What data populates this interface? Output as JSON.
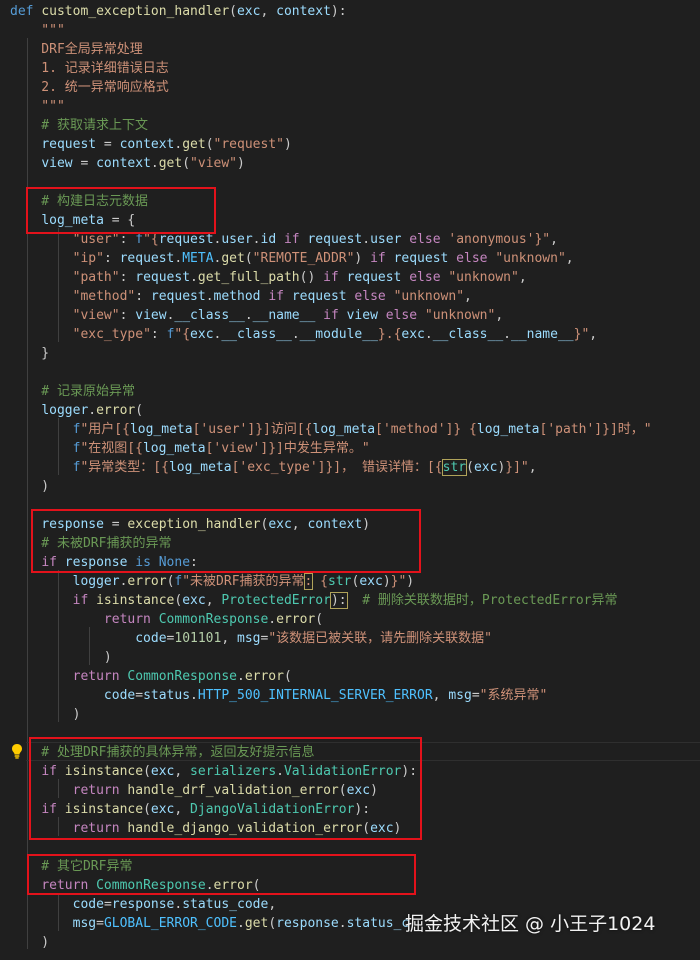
{
  "editor": {
    "theme_colors": {
      "background": "#1f1f1f",
      "keyword": "#569cd6",
      "control": "#c586c0",
      "function": "#dcdcaa",
      "variable": "#9cdcfe",
      "string": "#ce9178",
      "comment": "#6a9955",
      "class": "#4ec9b0",
      "number": "#b5cea8",
      "highlight_box": "#e3121b"
    },
    "gutter_icon": "lightbulb-icon",
    "lines": [
      [
        [
          "def ",
          "#569cd6"
        ],
        [
          "custom_exception_handler",
          "#dcdcaa"
        ],
        [
          "(",
          "#cccccc"
        ],
        [
          "exc",
          "#9cdcfe"
        ],
        [
          ", ",
          "#cccccc"
        ],
        [
          "context",
          "#9cdcfe"
        ],
        [
          "):",
          "#cccccc"
        ]
      ],
      [
        [
          "    \"\"\"",
          "#ce9178"
        ]
      ],
      [
        [
          "    DRF全局异常处理",
          "#ce9178"
        ]
      ],
      [
        [
          "    1. 记录详细错误日志",
          "#ce9178"
        ]
      ],
      [
        [
          "    2. 统一异常响应格式",
          "#ce9178"
        ]
      ],
      [
        [
          "    \"\"\"",
          "#ce9178"
        ]
      ],
      [
        [
          "    # 获取请求上下文",
          "#6a9955"
        ]
      ],
      [
        [
          "    ",
          "#cccccc"
        ],
        [
          "request",
          "#9cdcfe"
        ],
        [
          " = ",
          "#cccccc"
        ],
        [
          "context",
          "#9cdcfe"
        ],
        [
          ".",
          "#cccccc"
        ],
        [
          "get",
          "#dcdcaa"
        ],
        [
          "(",
          "#cccccc"
        ],
        [
          "\"request\"",
          "#ce9178"
        ],
        [
          ")",
          "#cccccc"
        ]
      ],
      [
        [
          "    ",
          "#cccccc"
        ],
        [
          "view",
          "#9cdcfe"
        ],
        [
          " = ",
          "#cccccc"
        ],
        [
          "context",
          "#9cdcfe"
        ],
        [
          ".",
          "#cccccc"
        ],
        [
          "get",
          "#dcdcaa"
        ],
        [
          "(",
          "#cccccc"
        ],
        [
          "\"view\"",
          "#ce9178"
        ],
        [
          ")",
          "#cccccc"
        ]
      ],
      [],
      [
        [
          "    # 构建日志元数据",
          "#6a9955"
        ]
      ],
      [
        [
          "    ",
          "#cccccc"
        ],
        [
          "log_meta",
          "#9cdcfe"
        ],
        [
          " = {",
          "#cccccc"
        ]
      ],
      [
        [
          "        ",
          "#cccccc"
        ],
        [
          "\"user\"",
          "#ce9178"
        ],
        [
          ": ",
          "#cccccc"
        ],
        [
          "f",
          "#569cd6"
        ],
        [
          "\"{",
          "#ce9178"
        ],
        [
          "request",
          "#9cdcfe"
        ],
        [
          ".",
          "#cccccc"
        ],
        [
          "user",
          "#9cdcfe"
        ],
        [
          ".",
          "#cccccc"
        ],
        [
          "id",
          "#9cdcfe"
        ],
        [
          " if ",
          "#c586c0"
        ],
        [
          "request",
          "#9cdcfe"
        ],
        [
          ".",
          "#cccccc"
        ],
        [
          "user",
          "#9cdcfe"
        ],
        [
          " else ",
          "#c586c0"
        ],
        [
          "'anonymous'",
          "#ce9178"
        ],
        [
          "}\"",
          "#ce9178"
        ],
        [
          ",",
          "#cccccc"
        ]
      ],
      [
        [
          "        ",
          "#cccccc"
        ],
        [
          "\"ip\"",
          "#ce9178"
        ],
        [
          ": ",
          "#cccccc"
        ],
        [
          "request",
          "#9cdcfe"
        ],
        [
          ".",
          "#cccccc"
        ],
        [
          "META",
          "#4fc1ff"
        ],
        [
          ".",
          "#cccccc"
        ],
        [
          "get",
          "#dcdcaa"
        ],
        [
          "(",
          "#cccccc"
        ],
        [
          "\"REMOTE_ADDR\"",
          "#ce9178"
        ],
        [
          ") ",
          "#cccccc"
        ],
        [
          "if ",
          "#c586c0"
        ],
        [
          "request",
          "#9cdcfe"
        ],
        [
          " else ",
          "#c586c0"
        ],
        [
          "\"unknown\"",
          "#ce9178"
        ],
        [
          ",",
          "#cccccc"
        ]
      ],
      [
        [
          "        ",
          "#cccccc"
        ],
        [
          "\"path\"",
          "#ce9178"
        ],
        [
          ": ",
          "#cccccc"
        ],
        [
          "request",
          "#9cdcfe"
        ],
        [
          ".",
          "#cccccc"
        ],
        [
          "get_full_path",
          "#dcdcaa"
        ],
        [
          "() ",
          "#cccccc"
        ],
        [
          "if ",
          "#c586c0"
        ],
        [
          "request",
          "#9cdcfe"
        ],
        [
          " else ",
          "#c586c0"
        ],
        [
          "\"unknown\"",
          "#ce9178"
        ],
        [
          ",",
          "#cccccc"
        ]
      ],
      [
        [
          "        ",
          "#cccccc"
        ],
        [
          "\"method\"",
          "#ce9178"
        ],
        [
          ": ",
          "#cccccc"
        ],
        [
          "request",
          "#9cdcfe"
        ],
        [
          ".",
          "#cccccc"
        ],
        [
          "method",
          "#9cdcfe"
        ],
        [
          " if ",
          "#c586c0"
        ],
        [
          "request",
          "#9cdcfe"
        ],
        [
          " else ",
          "#c586c0"
        ],
        [
          "\"unknown\"",
          "#ce9178"
        ],
        [
          ",",
          "#cccccc"
        ]
      ],
      [
        [
          "        ",
          "#cccccc"
        ],
        [
          "\"view\"",
          "#ce9178"
        ],
        [
          ": ",
          "#cccccc"
        ],
        [
          "view",
          "#9cdcfe"
        ],
        [
          ".",
          "#cccccc"
        ],
        [
          "__class__",
          "#9cdcfe"
        ],
        [
          ".",
          "#cccccc"
        ],
        [
          "__name__",
          "#9cdcfe"
        ],
        [
          " if ",
          "#c586c0"
        ],
        [
          "view",
          "#9cdcfe"
        ],
        [
          " else ",
          "#c586c0"
        ],
        [
          "\"unknown\"",
          "#ce9178"
        ],
        [
          ",",
          "#cccccc"
        ]
      ],
      [
        [
          "        ",
          "#cccccc"
        ],
        [
          "\"exc_type\"",
          "#ce9178"
        ],
        [
          ": ",
          "#cccccc"
        ],
        [
          "f",
          "#569cd6"
        ],
        [
          "\"{",
          "#ce9178"
        ],
        [
          "exc",
          "#9cdcfe"
        ],
        [
          ".",
          "#cccccc"
        ],
        [
          "__class__",
          "#9cdcfe"
        ],
        [
          ".",
          "#cccccc"
        ],
        [
          "__module__",
          "#9cdcfe"
        ],
        [
          "}.{",
          "#ce9178"
        ],
        [
          "exc",
          "#9cdcfe"
        ],
        [
          ".",
          "#cccccc"
        ],
        [
          "__class__",
          "#9cdcfe"
        ],
        [
          ".",
          "#cccccc"
        ],
        [
          "__name__",
          "#9cdcfe"
        ],
        [
          "}\"",
          "#ce9178"
        ],
        [
          ",",
          "#cccccc"
        ]
      ],
      [
        [
          "    }",
          "#cccccc"
        ]
      ],
      [],
      [
        [
          "    # 记录原始异常",
          "#6a9955"
        ]
      ],
      [
        [
          "    ",
          "#cccccc"
        ],
        [
          "logger",
          "#9cdcfe"
        ],
        [
          ".",
          "#cccccc"
        ],
        [
          "error",
          "#dcdcaa"
        ],
        [
          "(",
          "#cccccc"
        ]
      ],
      [
        [
          "        ",
          "#cccccc"
        ],
        [
          "f",
          "#569cd6"
        ],
        [
          "\"用户[{",
          "#ce9178"
        ],
        [
          "log_meta",
          "#9cdcfe"
        ],
        [
          "['user']",
          "#ce9178"
        ],
        [
          "}]访问[{",
          "#ce9178"
        ],
        [
          "log_meta",
          "#9cdcfe"
        ],
        [
          "['method']",
          "#ce9178"
        ],
        [
          "} {",
          "#ce9178"
        ],
        [
          "log_meta",
          "#9cdcfe"
        ],
        [
          "['path']",
          "#ce9178"
        ],
        [
          "}]时，\"",
          "#ce9178"
        ]
      ],
      [
        [
          "        ",
          "#cccccc"
        ],
        [
          "f",
          "#569cd6"
        ],
        [
          "\"在视图[{",
          "#ce9178"
        ],
        [
          "log_meta",
          "#9cdcfe"
        ],
        [
          "['view']",
          "#ce9178"
        ],
        [
          "}]中发生异常。\"",
          "#ce9178"
        ]
      ],
      [
        [
          "        ",
          "#cccccc"
        ],
        [
          "f",
          "#569cd6"
        ],
        [
          "\"异常类型：[{",
          "#ce9178"
        ],
        [
          "log_meta",
          "#9cdcfe"
        ],
        [
          "['exc_type']",
          "#ce9178"
        ],
        [
          "}]",
          "#ce9178"
        ],
        [
          "，",
          "#ce9178"
        ],
        [
          " 错误详情：[{",
          "#ce9178"
        ],
        [
          "str",
          "#4ec9b0"
        ],
        [
          "(",
          "#cccccc"
        ],
        [
          "exc",
          "#9cdcfe"
        ],
        [
          ")",
          "#cccccc"
        ],
        [
          "}]\"",
          "#ce9178"
        ],
        [
          ",",
          "#cccccc"
        ]
      ],
      [
        [
          "    )",
          "#cccccc"
        ]
      ],
      [],
      [
        [
          "    ",
          "#cccccc"
        ],
        [
          "response",
          "#9cdcfe"
        ],
        [
          " = ",
          "#cccccc"
        ],
        [
          "exception_handler",
          "#dcdcaa"
        ],
        [
          "(",
          "#cccccc"
        ],
        [
          "exc",
          "#9cdcfe"
        ],
        [
          ", ",
          "#cccccc"
        ],
        [
          "context",
          "#9cdcfe"
        ],
        [
          ")",
          "#cccccc"
        ]
      ],
      [
        [
          "    # 未被DRF捕获的异常",
          "#6a9955"
        ]
      ],
      [
        [
          "    ",
          "#cccccc"
        ],
        [
          "if ",
          "#c586c0"
        ],
        [
          "response",
          "#9cdcfe"
        ],
        [
          " is ",
          "#569cd6"
        ],
        [
          "None",
          "#569cd6"
        ],
        [
          ":",
          "#cccccc"
        ]
      ],
      [
        [
          "        ",
          "#cccccc"
        ],
        [
          "logger",
          "#9cdcfe"
        ],
        [
          ".",
          "#cccccc"
        ],
        [
          "error",
          "#dcdcaa"
        ],
        [
          "(",
          "#cccccc"
        ],
        [
          "f",
          "#569cd6"
        ],
        [
          "\"未被DRF捕获的异常",
          "#ce9178"
        ],
        [
          ":",
          "#ce9178"
        ],
        [
          " {",
          "#ce9178"
        ],
        [
          "str",
          "#4ec9b0"
        ],
        [
          "(",
          "#cccccc"
        ],
        [
          "exc",
          "#9cdcfe"
        ],
        [
          ")",
          "#cccccc"
        ],
        [
          "}\"",
          "#ce9178"
        ],
        [
          ")",
          "#cccccc"
        ]
      ],
      [
        [
          "        ",
          "#cccccc"
        ],
        [
          "if ",
          "#c586c0"
        ],
        [
          "isinstance",
          "#dcdcaa"
        ],
        [
          "(",
          "#cccccc"
        ],
        [
          "exc",
          "#9cdcfe"
        ],
        [
          ", ",
          "#cccccc"
        ],
        [
          "ProtectedError",
          "#4ec9b0"
        ],
        [
          "):",
          "#cccccc"
        ],
        [
          "  # 删除关联数据时，ProtectedError异常",
          "#6a9955"
        ]
      ],
      [
        [
          "            ",
          "#cccccc"
        ],
        [
          "return ",
          "#c586c0"
        ],
        [
          "CommonResponse",
          "#4ec9b0"
        ],
        [
          ".",
          "#cccccc"
        ],
        [
          "error",
          "#dcdcaa"
        ],
        [
          "(",
          "#cccccc"
        ]
      ],
      [
        [
          "                ",
          "#cccccc"
        ],
        [
          "code",
          "#9cdcfe"
        ],
        [
          "=",
          "#cccccc"
        ],
        [
          "101101",
          "#b5cea8"
        ],
        [
          ", ",
          "#cccccc"
        ],
        [
          "msg",
          "#9cdcfe"
        ],
        [
          "=",
          "#cccccc"
        ],
        [
          "\"该数据已被关联，请先删除关联数据\"",
          "#ce9178"
        ]
      ],
      [
        [
          "            )",
          "#cccccc"
        ]
      ],
      [
        [
          "        ",
          "#cccccc"
        ],
        [
          "return ",
          "#c586c0"
        ],
        [
          "CommonResponse",
          "#4ec9b0"
        ],
        [
          ".",
          "#cccccc"
        ],
        [
          "error",
          "#dcdcaa"
        ],
        [
          "(",
          "#cccccc"
        ]
      ],
      [
        [
          "            ",
          "#cccccc"
        ],
        [
          "code",
          "#9cdcfe"
        ],
        [
          "=",
          "#cccccc"
        ],
        [
          "status",
          "#9cdcfe"
        ],
        [
          ".",
          "#cccccc"
        ],
        [
          "HTTP_500_INTERNAL_SERVER_ERROR",
          "#4fc1ff"
        ],
        [
          ", ",
          "#cccccc"
        ],
        [
          "msg",
          "#9cdcfe"
        ],
        [
          "=",
          "#cccccc"
        ],
        [
          "\"系统异常\"",
          "#ce9178"
        ]
      ],
      [
        [
          "        )",
          "#cccccc"
        ]
      ],
      [],
      [
        [
          "    # 处理DRF捕获的具体异常，返回友好提示信息",
          "#6a9955"
        ]
      ],
      [
        [
          "    ",
          "#cccccc"
        ],
        [
          "if ",
          "#c586c0"
        ],
        [
          "isinstance",
          "#dcdcaa"
        ],
        [
          "(",
          "#cccccc"
        ],
        [
          "exc",
          "#9cdcfe"
        ],
        [
          ", ",
          "#cccccc"
        ],
        [
          "serializers",
          "#4ec9b0"
        ],
        [
          ".",
          "#cccccc"
        ],
        [
          "ValidationError",
          "#4ec9b0"
        ],
        [
          "):",
          "#cccccc"
        ]
      ],
      [
        [
          "        ",
          "#cccccc"
        ],
        [
          "return ",
          "#c586c0"
        ],
        [
          "handle_drf_validation_error",
          "#dcdcaa"
        ],
        [
          "(",
          "#cccccc"
        ],
        [
          "exc",
          "#9cdcfe"
        ],
        [
          ")",
          "#cccccc"
        ]
      ],
      [
        [
          "    ",
          "#cccccc"
        ],
        [
          "if ",
          "#c586c0"
        ],
        [
          "isinstance",
          "#dcdcaa"
        ],
        [
          "(",
          "#cccccc"
        ],
        [
          "exc",
          "#9cdcfe"
        ],
        [
          ", ",
          "#cccccc"
        ],
        [
          "DjangoValidationError",
          "#4ec9b0"
        ],
        [
          "):",
          "#cccccc"
        ]
      ],
      [
        [
          "        ",
          "#cccccc"
        ],
        [
          "return ",
          "#c586c0"
        ],
        [
          "handle_django_validation_error",
          "#dcdcaa"
        ],
        [
          "(",
          "#cccccc"
        ],
        [
          "exc",
          "#9cdcfe"
        ],
        [
          ")",
          "#cccccc"
        ]
      ],
      [],
      [
        [
          "    # 其它DRF异常",
          "#6a9955"
        ]
      ],
      [
        [
          "    ",
          "#cccccc"
        ],
        [
          "return ",
          "#c586c0"
        ],
        [
          "CommonResponse",
          "#4ec9b0"
        ],
        [
          ".",
          "#cccccc"
        ],
        [
          "error",
          "#dcdcaa"
        ],
        [
          "(",
          "#cccccc"
        ]
      ],
      [
        [
          "        ",
          "#cccccc"
        ],
        [
          "code",
          "#9cdcfe"
        ],
        [
          "=",
          "#cccccc"
        ],
        [
          "response",
          "#9cdcfe"
        ],
        [
          ".",
          "#cccccc"
        ],
        [
          "status_code",
          "#9cdcfe"
        ],
        [
          ",",
          "#cccccc"
        ]
      ],
      [
        [
          "        ",
          "#cccccc"
        ],
        [
          "msg",
          "#9cdcfe"
        ],
        [
          "=",
          "#cccccc"
        ],
        [
          "GLOBAL_ERROR_CODE",
          "#4fc1ff"
        ],
        [
          ".",
          "#cccccc"
        ],
        [
          "get",
          "#dcdcaa"
        ],
        [
          "(",
          "#cccccc"
        ],
        [
          "response",
          "#9cdcfe"
        ],
        [
          ".",
          "#cccccc"
        ],
        [
          "status_c",
          "#9cdcfe"
        ]
      ],
      [
        [
          "    )",
          "#cccccc"
        ]
      ]
    ]
  },
  "watermark": {
    "text": "掘金技术社区 @ 小王子1024"
  }
}
